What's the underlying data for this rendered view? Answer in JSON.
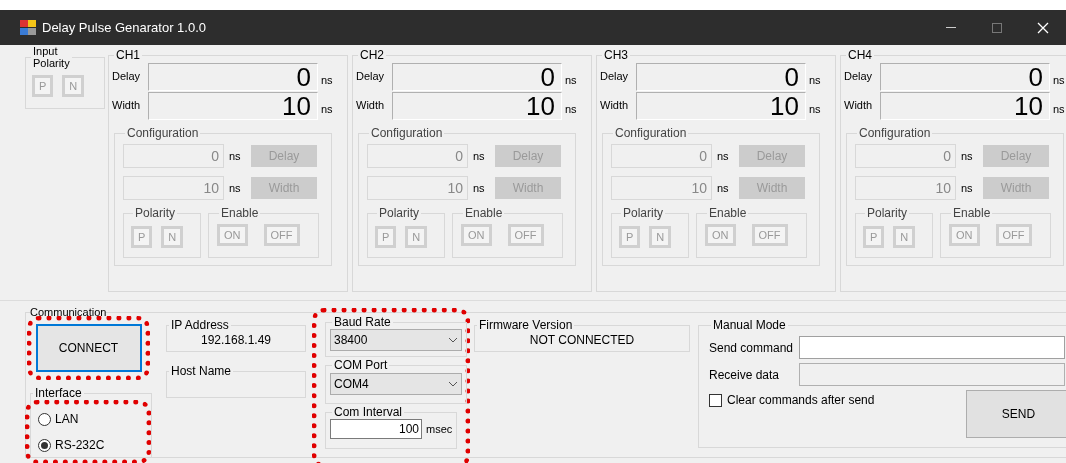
{
  "window": {
    "title": "Delay Pulse Genarator 1.0.0"
  },
  "input_polarity": {
    "title_lines": [
      "Input",
      "Polarity"
    ],
    "buttons": [
      "P",
      "N"
    ]
  },
  "channels": [
    {
      "title": "CH1",
      "delay_label": "Delay",
      "delay_value": "0",
      "delay_unit": "ns",
      "width_label": "Width",
      "width_value": "10",
      "width_unit": "ns",
      "configuration": {
        "title": "Configuration",
        "disabled": true,
        "delay_value": "0",
        "delay_unit": "ns",
        "delay_button": "Delay",
        "width_value": "10",
        "width_unit": "ns",
        "width_button": "Width",
        "polarity_title": "Polarity",
        "polarity_buttons": [
          "P",
          "N"
        ],
        "enable_title": "Enable",
        "enable_buttons": [
          "ON",
          "OFF"
        ]
      }
    },
    {
      "title": "CH2",
      "delay_label": "Delay",
      "delay_value": "0",
      "delay_unit": "ns",
      "width_label": "Width",
      "width_value": "10",
      "width_unit": "ns",
      "configuration": {
        "title": "Configuration",
        "disabled": true,
        "delay_value": "0",
        "delay_unit": "ns",
        "delay_button": "Delay",
        "width_value": "10",
        "width_unit": "ns",
        "width_button": "Width",
        "polarity_title": "Polarity",
        "polarity_buttons": [
          "P",
          "N"
        ],
        "enable_title": "Enable",
        "enable_buttons": [
          "ON",
          "OFF"
        ]
      }
    },
    {
      "title": "CH3",
      "delay_label": "Delay",
      "delay_value": "0",
      "delay_unit": "ns",
      "width_label": "Width",
      "width_value": "10",
      "width_unit": "ns",
      "configuration": {
        "title": "Configuration",
        "disabled": true,
        "delay_value": "0",
        "delay_unit": "ns",
        "delay_button": "Delay",
        "width_value": "10",
        "width_unit": "ns",
        "width_button": "Width",
        "polarity_title": "Polarity",
        "polarity_buttons": [
          "P",
          "N"
        ],
        "enable_title": "Enable",
        "enable_buttons": [
          "ON",
          "OFF"
        ]
      }
    },
    {
      "title": "CH4",
      "delay_label": "Delay",
      "delay_value": "0",
      "delay_unit": "ns",
      "width_label": "Width",
      "width_value": "10",
      "width_unit": "ns",
      "configuration": {
        "title": "Configuration",
        "disabled": true,
        "delay_value": "0",
        "delay_unit": "ns",
        "delay_button": "Delay",
        "width_value": "10",
        "width_unit": "ns",
        "width_button": "Width",
        "polarity_title": "Polarity",
        "polarity_buttons": [
          "P",
          "N"
        ],
        "enable_title": "Enable",
        "enable_buttons": [
          "ON",
          "OFF"
        ]
      }
    }
  ],
  "communication": {
    "title": "Communication",
    "connect_button": "CONNECT",
    "interface": {
      "title": "Interface",
      "options": [
        {
          "label": "LAN",
          "selected": false
        },
        {
          "label": "RS-232C",
          "selected": true
        }
      ]
    },
    "ip_address": {
      "title": "IP Address",
      "value": "192.168.1.49"
    },
    "host_name": {
      "title": "Host Name"
    },
    "baud_rate": {
      "title": "Baud Rate",
      "value": "38400"
    },
    "com_port": {
      "title": "COM Port",
      "value": "COM4"
    },
    "com_interval": {
      "title": "Com Interval",
      "value": "100",
      "unit": "msec"
    },
    "firmware_version": {
      "title": "Firmware Version",
      "value": "NOT CONNECTED"
    },
    "manual_mode": {
      "title": "Manual Mode",
      "send_label": "Send command",
      "receive_label": "Receive data",
      "clear_checkbox": {
        "label": "Clear commands after send",
        "checked": false
      },
      "send_button": "SEND"
    }
  }
}
